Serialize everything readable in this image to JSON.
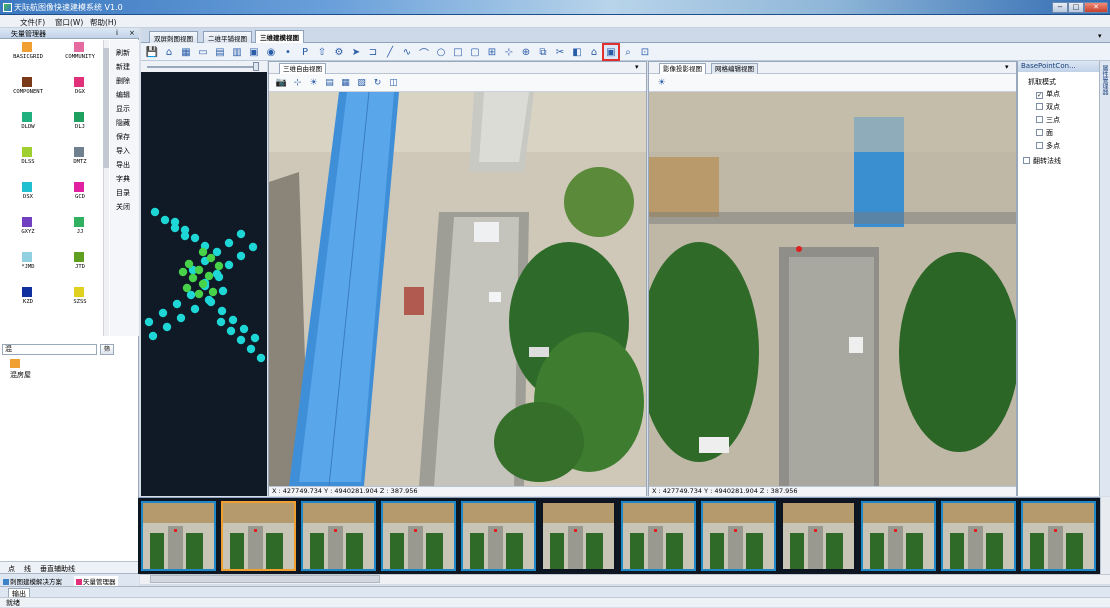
{
  "window": {
    "title": "天际航图像快速建模系统 V1.0",
    "min": "−",
    "max": "□",
    "close": "✕"
  },
  "menu": [
    "文件(F)",
    "窗口(W)",
    "帮助(H)"
  ],
  "left_panel": {
    "title": "矢量管理器",
    "pin": "ⅰ",
    "close": "×",
    "layers": [
      {
        "name": "BASICGRID",
        "color": "#f0a030"
      },
      {
        "name": "COMMUNITY",
        "color": "#e46aa0"
      },
      {
        "name": "COMPONENT",
        "color": "#7a3a1a"
      },
      {
        "name": "DGX",
        "color": "#e0307a"
      },
      {
        "name": "DLDW",
        "color": "#20b080"
      },
      {
        "name": "DLJ",
        "color": "#20a060"
      },
      {
        "name": "DLSS",
        "color": "#a0d030"
      },
      {
        "name": "DMTZ",
        "color": "#708090"
      },
      {
        "name": "DSX",
        "color": "#20c0d0"
      },
      {
        "name": "GCD",
        "color": "#e020a0"
      },
      {
        "name": "GXYZ",
        "color": "#7040c0"
      },
      {
        "name": "JJ",
        "color": "#30b060"
      },
      {
        "name": "*JMD",
        "color": "#90d0e0"
      },
      {
        "name": "JTD",
        "color": "#60a020"
      },
      {
        "name": "KZD",
        "color": "#1030a0"
      },
      {
        "name": "SZSS",
        "color": "#e0d020"
      }
    ],
    "actions": [
      "刷新",
      "新建",
      "删除",
      "编辑",
      "显示",
      "隐藏",
      "保存",
      "导入",
      "导出",
      "字典",
      "目录",
      "关闭"
    ],
    "filter_value": "混",
    "filter_button": "筛",
    "result": {
      "name": "混房屋",
      "color": "#f0a030"
    },
    "bottom_tabs": [
      "点",
      "线",
      "垂直辅助线"
    ],
    "solution_tabs": [
      "刺图建模解决方案",
      "矢量管理器"
    ]
  },
  "doc_tabs": [
    "双屏刺图视图",
    "二维平铺视图",
    "三维建模视图"
  ],
  "toolbar_icons": [
    "save-icon",
    "home-icon",
    "grid-icon",
    "window-icon",
    "layout-icon",
    "layout2-icon",
    "image-icon",
    "globe-icon",
    "point-icon",
    "px-icon",
    "up-icon",
    "wrench-icon",
    "pointer-icon",
    "rect-open-icon",
    "line-icon",
    "polyline-icon",
    "arc-icon",
    "circle-icon",
    "rect-icon",
    "rect2-icon",
    "measure-icon",
    "plus-icon",
    "attach-icon",
    "copy-icon",
    "scissors-icon",
    "mirror-icon",
    "house-icon",
    "select-box-icon",
    "zoom-icon",
    "fit-icon"
  ],
  "left_view": {
    "tab": "三维自由视图",
    "coords": "X : 427749.734  Y : 4940281.904  Z : 387.956",
    "tools": [
      "camera-icon",
      "move-icon",
      "sun-icon",
      "asu-icon",
      "wireframe-icon",
      "solid-icon",
      "rotate-icon",
      "layers-icon"
    ]
  },
  "right_view": {
    "tabs": [
      "影像投影视图",
      "网格编辑视图"
    ],
    "coords": "X : 427749.734  Y : 4940281.904  Z : 387.956",
    "tools": [
      "sun-icon"
    ]
  },
  "props": {
    "title": "BasePointCon...",
    "group": "抓取模式",
    "options": [
      {
        "label": "单点",
        "checked": true
      },
      {
        "label": "双点",
        "checked": false
      },
      {
        "label": "三点",
        "checked": false
      },
      {
        "label": "面",
        "checked": false
      },
      {
        "label": "多点",
        "checked": false
      }
    ],
    "flip": "翻转法线",
    "side_label": "属性管理器"
  },
  "output_tab": "输出",
  "status": "就绪"
}
